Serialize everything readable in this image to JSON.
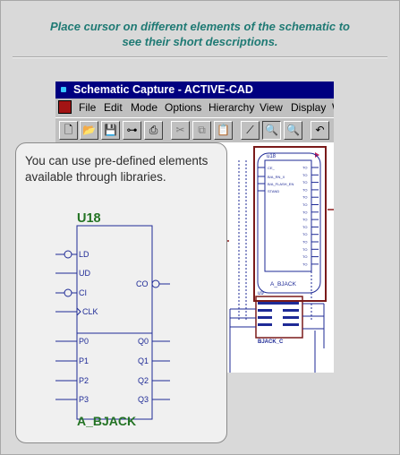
{
  "instruction": {
    "line1": "Place cursor on different elements of the schematic to",
    "line2": "see their short descriptions."
  },
  "app": {
    "title": "Schematic Capture - ACTIVE-CAD",
    "menu": [
      "File",
      "Edit",
      "Mode",
      "Options",
      "Hierarchy",
      "View",
      "Display",
      "W"
    ],
    "toolbar": [
      {
        "icon": "new-document-icon",
        "glyph": "🗋"
      },
      {
        "icon": "open-folder-icon",
        "glyph": "📂"
      },
      {
        "icon": "save-disk-icon",
        "glyph": "💾"
      },
      {
        "icon": "hierarchy-tree-icon",
        "glyph": "⊶"
      },
      {
        "icon": "print-icon",
        "glyph": "⎙"
      },
      {
        "icon": "cut-icon",
        "glyph": "✂"
      },
      {
        "icon": "copy-icon",
        "glyph": "⧉"
      },
      {
        "icon": "paste-icon",
        "glyph": "📋"
      },
      {
        "icon": "draw-wire-icon",
        "glyph": "⟋"
      },
      {
        "icon": "zoom-icon",
        "glyph": "🔍"
      },
      {
        "icon": "zoom-area-icon",
        "glyph": "🔍"
      },
      {
        "icon": "undo-icon",
        "glyph": "↶"
      }
    ],
    "schematic": {
      "symbol_ref": "u18",
      "symbol_name": "A_BJACK",
      "left_pins": [
        "CE_",
        "B/A_RN_X",
        "B/A_FLASH_EN",
        "STAND"
      ],
      "right_pins": [
        "TO",
        "TO",
        "TO",
        "TO",
        "TO",
        "TO",
        "TO",
        "TO",
        "TO",
        "TO",
        "TO",
        "TO",
        "TO",
        "TO"
      ],
      "second_ref": "u9",
      "second_name": "BJACK_C",
      "colors": {
        "highlight": "#7a1a1a",
        "wire": "#1e2a96"
      }
    }
  },
  "callout": {
    "text": "You can use pre-defined elements available through libraries.",
    "symbol": {
      "ref": "U18",
      "name": "A_BJACK",
      "inputs": [
        "LD",
        "UD",
        "CI",
        "CLK"
      ],
      "output": "CO",
      "data_inputs": [
        "P0",
        "P1",
        "P2",
        "P3"
      ],
      "data_outputs": [
        "Q0",
        "Q1",
        "Q2",
        "Q3"
      ],
      "label_color": "#237323"
    }
  }
}
